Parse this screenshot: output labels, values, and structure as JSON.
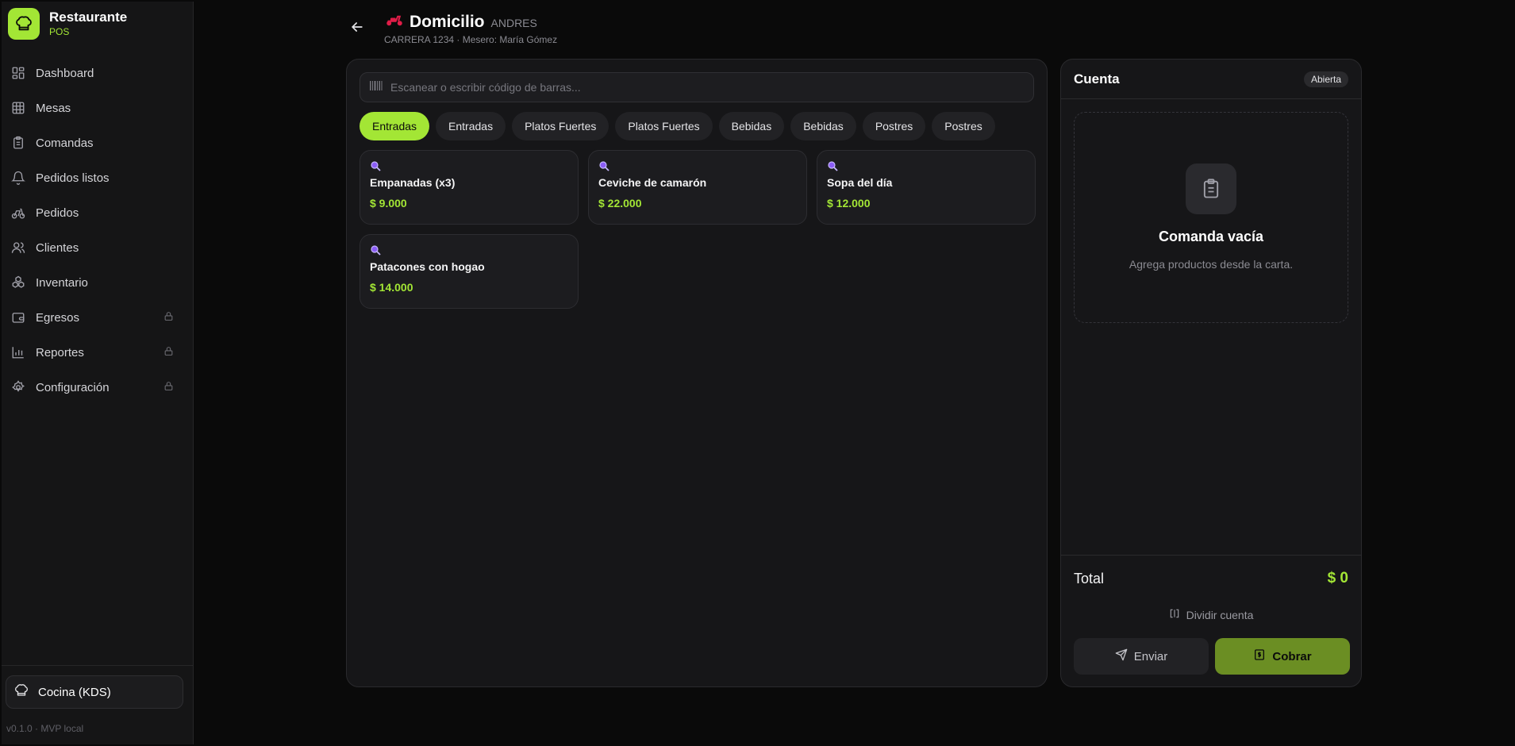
{
  "brand": {
    "name": "Restaurante",
    "sub": "POS"
  },
  "nav": [
    {
      "label": "Dashboard",
      "icon": "dashboard-icon",
      "locked": false
    },
    {
      "label": "Mesas",
      "icon": "table-grid-icon",
      "locked": false
    },
    {
      "label": "Comandas",
      "icon": "clipboard-icon",
      "locked": false
    },
    {
      "label": "Pedidos listos",
      "icon": "bell-icon",
      "locked": false
    },
    {
      "label": "Pedidos",
      "icon": "bike-icon",
      "locked": false
    },
    {
      "label": "Clientes",
      "icon": "users-icon",
      "locked": false
    },
    {
      "label": "Inventario",
      "icon": "boxes-icon",
      "locked": false
    },
    {
      "label": "Egresos",
      "icon": "wallet-icon",
      "locked": true
    },
    {
      "label": "Reportes",
      "icon": "bar-chart-icon",
      "locked": true
    },
    {
      "label": "Configuración",
      "icon": "gear-icon",
      "locked": true
    }
  ],
  "kds": {
    "label": "Cocina (KDS)"
  },
  "version": "v0.1.0 · MVP local",
  "header": {
    "title": "Domicilio",
    "customer": "ANDRES",
    "subtitle": "CARRERA 1234 · Mesero: María Gómez"
  },
  "search": {
    "placeholder": "Escanear o escribir código de barras..."
  },
  "tabs": [
    {
      "label": "Entradas",
      "active": true
    },
    {
      "label": "Entradas",
      "active": false
    },
    {
      "label": "Platos Fuertes",
      "active": false
    },
    {
      "label": "Platos Fuertes",
      "active": false
    },
    {
      "label": "Bebidas",
      "active": false
    },
    {
      "label": "Bebidas",
      "active": false
    },
    {
      "label": "Postres",
      "active": false
    },
    {
      "label": "Postres",
      "active": false
    }
  ],
  "products": [
    {
      "name": "Empanadas (x3)",
      "price": "$ 9.000"
    },
    {
      "name": "Ceviche de camarón",
      "price": "$ 22.000"
    },
    {
      "name": "Sopa del día",
      "price": "$ 12.000"
    },
    {
      "name": "Patacones con hogao",
      "price": "$ 14.000"
    }
  ],
  "account": {
    "title": "Cuenta",
    "status": "Abierta",
    "empty_title": "Comanda vacía",
    "empty_sub": "Agrega productos desde la carta.",
    "total_label": "Total",
    "total_value": "$ 0",
    "split_label": "Dividir cuenta",
    "send_label": "Enviar",
    "pay_label": "Cobrar"
  },
  "colors": {
    "accent": "#a3e635",
    "pay_button": "#6b8e23",
    "background": "#0a0a0a",
    "panel": "#161618"
  }
}
